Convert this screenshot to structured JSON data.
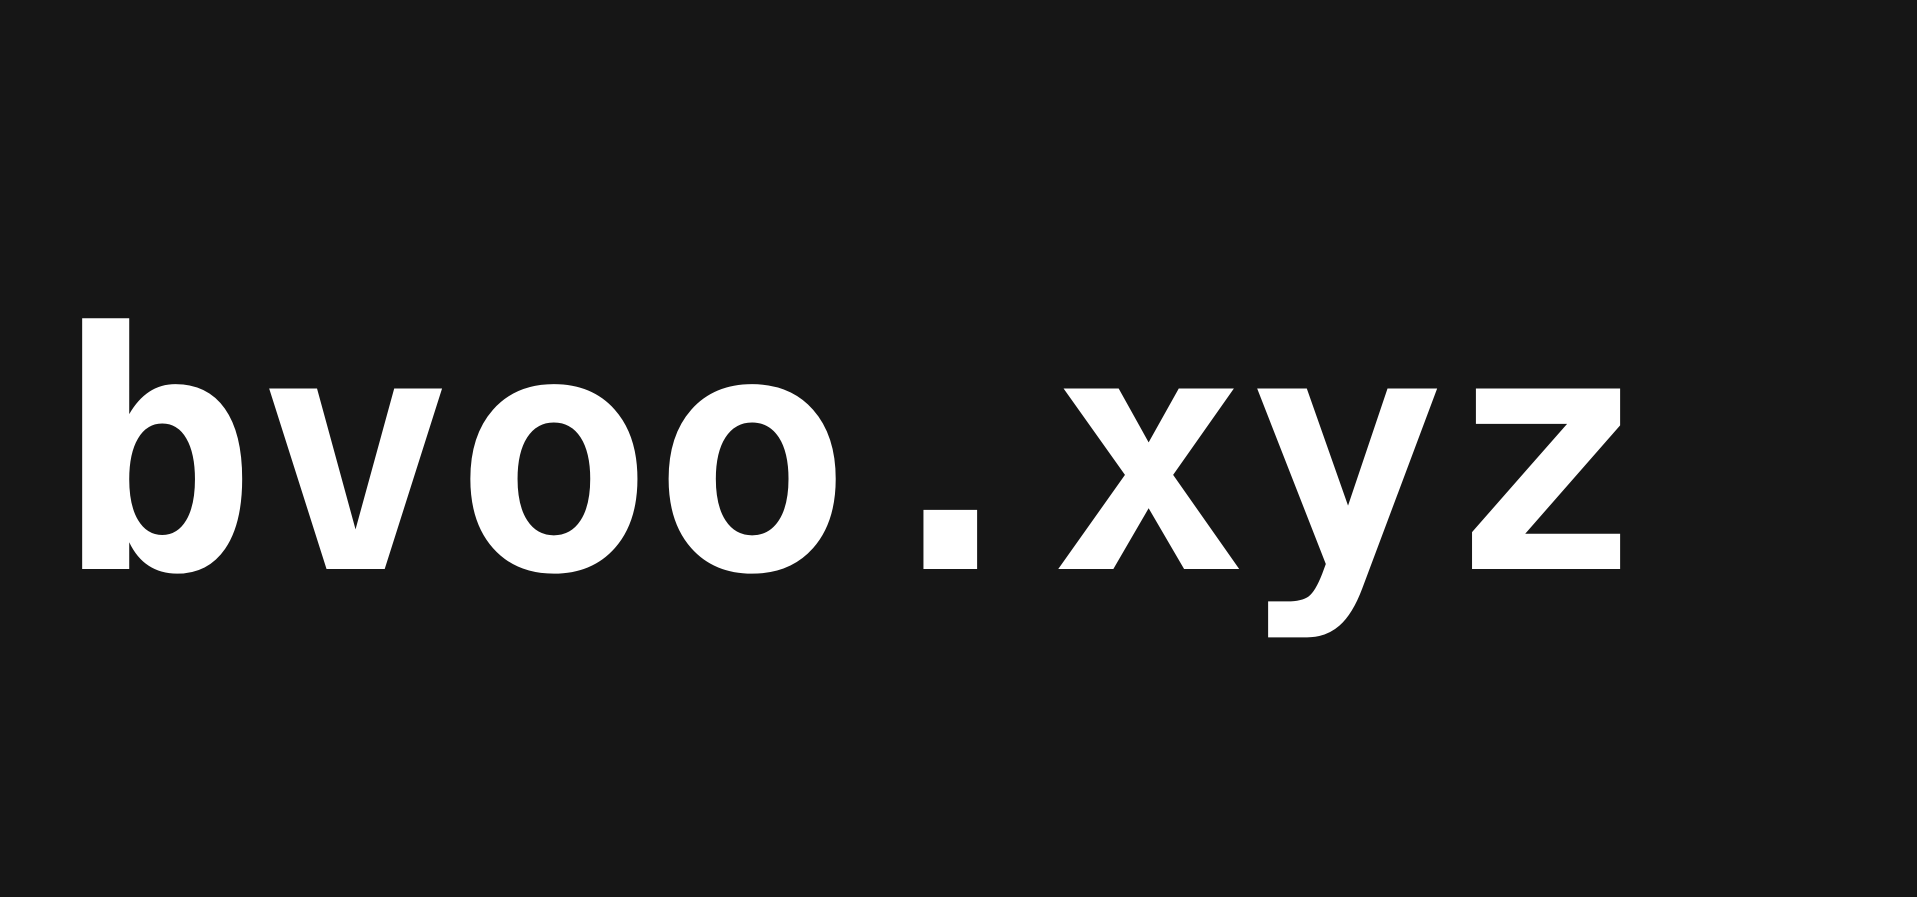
{
  "logo": {
    "text": "bvoo.xyz"
  },
  "colors": {
    "background": "#161616",
    "text": "#ffffff"
  }
}
